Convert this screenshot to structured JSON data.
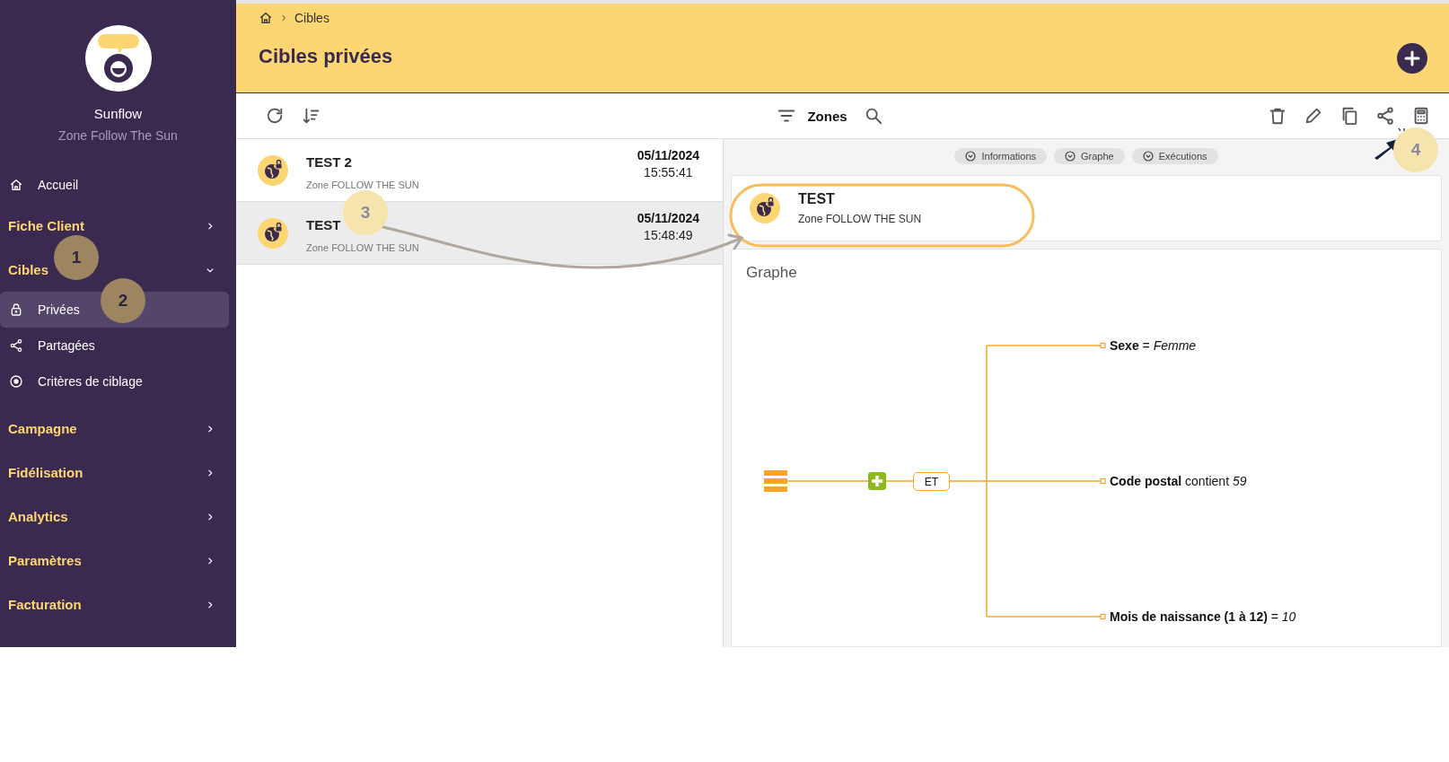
{
  "sidebar": {
    "brand": {
      "name": "Sunflow",
      "subtitle": "Zone Follow The Sun"
    },
    "items": [
      {
        "kind": "link",
        "label": "Accueil",
        "selected": false
      },
      {
        "kind": "section",
        "label": "Fiche Client",
        "expanded": false
      },
      {
        "kind": "section",
        "label": "Cibles",
        "expanded": true
      },
      {
        "kind": "sub",
        "label": "Privées",
        "selected": true
      },
      {
        "kind": "sub",
        "label": "Partagées",
        "selected": false
      },
      {
        "kind": "sub",
        "label": "Critères de ciblage",
        "selected": false
      },
      {
        "kind": "section",
        "label": "Campagne",
        "expanded": false
      },
      {
        "kind": "section",
        "label": "Fidélisation",
        "expanded": false
      },
      {
        "kind": "section",
        "label": "Analytics",
        "expanded": false
      },
      {
        "kind": "section",
        "label": "Paramètres",
        "expanded": false
      },
      {
        "kind": "section",
        "label": "Facturation",
        "expanded": false
      }
    ]
  },
  "header": {
    "breadcrumb": [
      "Cibles"
    ],
    "title": "Cibles privées"
  },
  "toolbar": {
    "filter_label": "Zones"
  },
  "list": [
    {
      "title": "TEST 2",
      "subtitle": "Zone FOLLOW THE SUN",
      "date": "05/11/2024",
      "time": "15:55:41",
      "selected": false
    },
    {
      "title": "TEST",
      "subtitle": "Zone FOLLOW THE SUN",
      "date": "05/11/2024",
      "time": "15:48:49",
      "selected": true
    }
  ],
  "detail": {
    "tabs": [
      {
        "label": "Informations"
      },
      {
        "label": "Graphe"
      },
      {
        "label": "Exécutions"
      }
    ],
    "card": {
      "title": "TEST",
      "subtitle": "Zone FOLLOW THE SUN"
    },
    "graph": {
      "title": "Graphe",
      "operator": "ET",
      "conditions": [
        {
          "field": "Sexe",
          "operator": "=",
          "value": "Femme"
        },
        {
          "field": "Code postal",
          "operator": "contient",
          "value": "59"
        },
        {
          "field": "Mois de naissance (1 à 12)",
          "operator": "=",
          "value": "10"
        }
      ]
    }
  },
  "annotations": [
    {
      "label": "1",
      "color": "#9c8560"
    },
    {
      "label": "2",
      "color": "#9c8560"
    },
    {
      "label": "3",
      "color": "#f6e4ad"
    },
    {
      "label": "4",
      "color": "#f6e4ad"
    }
  ]
}
